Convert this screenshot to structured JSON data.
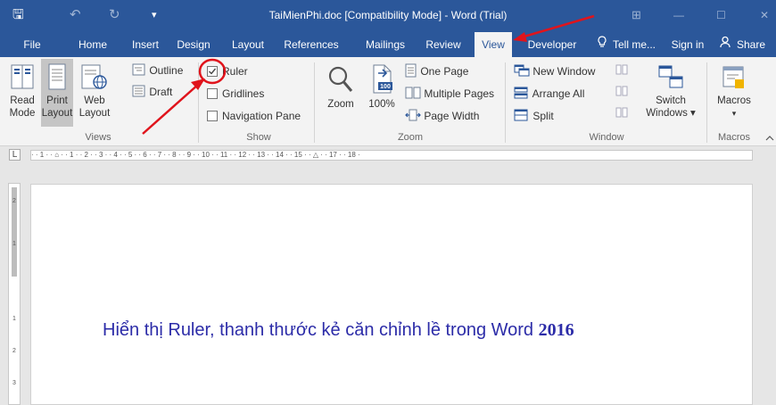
{
  "window": {
    "title": "TaiMienPhi.doc [Compatibility Mode] - Word (Trial)",
    "save_glyph": "🖫",
    "undo_glyph": "↶",
    "redo_glyph": "↻",
    "qat_glyph": "▾",
    "restore_glyph": "⊞",
    "minimize_glyph": "—",
    "maximize_glyph": "☐",
    "close_glyph": "✕"
  },
  "tabs": [
    "File",
    "Home",
    "Insert",
    "Design",
    "Layout",
    "References",
    "Mailings",
    "Review",
    "View",
    "Developer"
  ],
  "active_tab": "View",
  "tell_me": "Tell me...",
  "sign_in": "Sign in",
  "share": "Share",
  "views": {
    "read_mode": [
      "Read",
      "Mode"
    ],
    "print_layout": [
      "Print",
      "Layout"
    ],
    "web_layout": [
      "Web",
      "Layout"
    ],
    "outline": "Outline",
    "draft": "Draft",
    "group_label": "Views"
  },
  "show": {
    "ruler": {
      "label": "Ruler",
      "checked": true
    },
    "gridlines": {
      "label": "Gridlines",
      "checked": false
    },
    "navigation_pane": {
      "label": "Navigation Pane",
      "checked": false
    },
    "group_label": "Show"
  },
  "zoom": {
    "zoom": "Zoom",
    "percent": "100%",
    "percent_icon": "100",
    "one_page": "One Page",
    "multiple_pages": "Multiple Pages",
    "page_width": "Page Width",
    "group_label": "Zoom"
  },
  "window_group": {
    "new_window": "New Window",
    "arrange_all": "Arrange All",
    "split": "Split",
    "switch_windows": [
      "Switch",
      "Windows ▾"
    ],
    "group_label": "Window"
  },
  "macros": {
    "label": "Macros",
    "arrow": "▾",
    "group_label": "Macros"
  },
  "ruler": {
    "tab_marker": "L",
    "scale": "· · 1 · · ⌂ · · 1 · · 2 · · 3 · · 4 · · 5 · · 6 · · 7 · · 8 · · 9 · · 10 · · 11 · · 12 · · 13 · · 14 · · 15 · · △ · · 17 · · 18 ·",
    "vertical_numbers": [
      "2",
      "1",
      "1",
      "2",
      "3"
    ]
  },
  "document": {
    "caption_text": "Hiển thị Ruler, thanh thước kẻ căn chỉnh lề trong Word ",
    "caption_year": "2016"
  },
  "colors": {
    "word_blue": "#2b579a",
    "annotation_red": "#e0141c",
    "caption_blue": "#2c2ca8"
  }
}
